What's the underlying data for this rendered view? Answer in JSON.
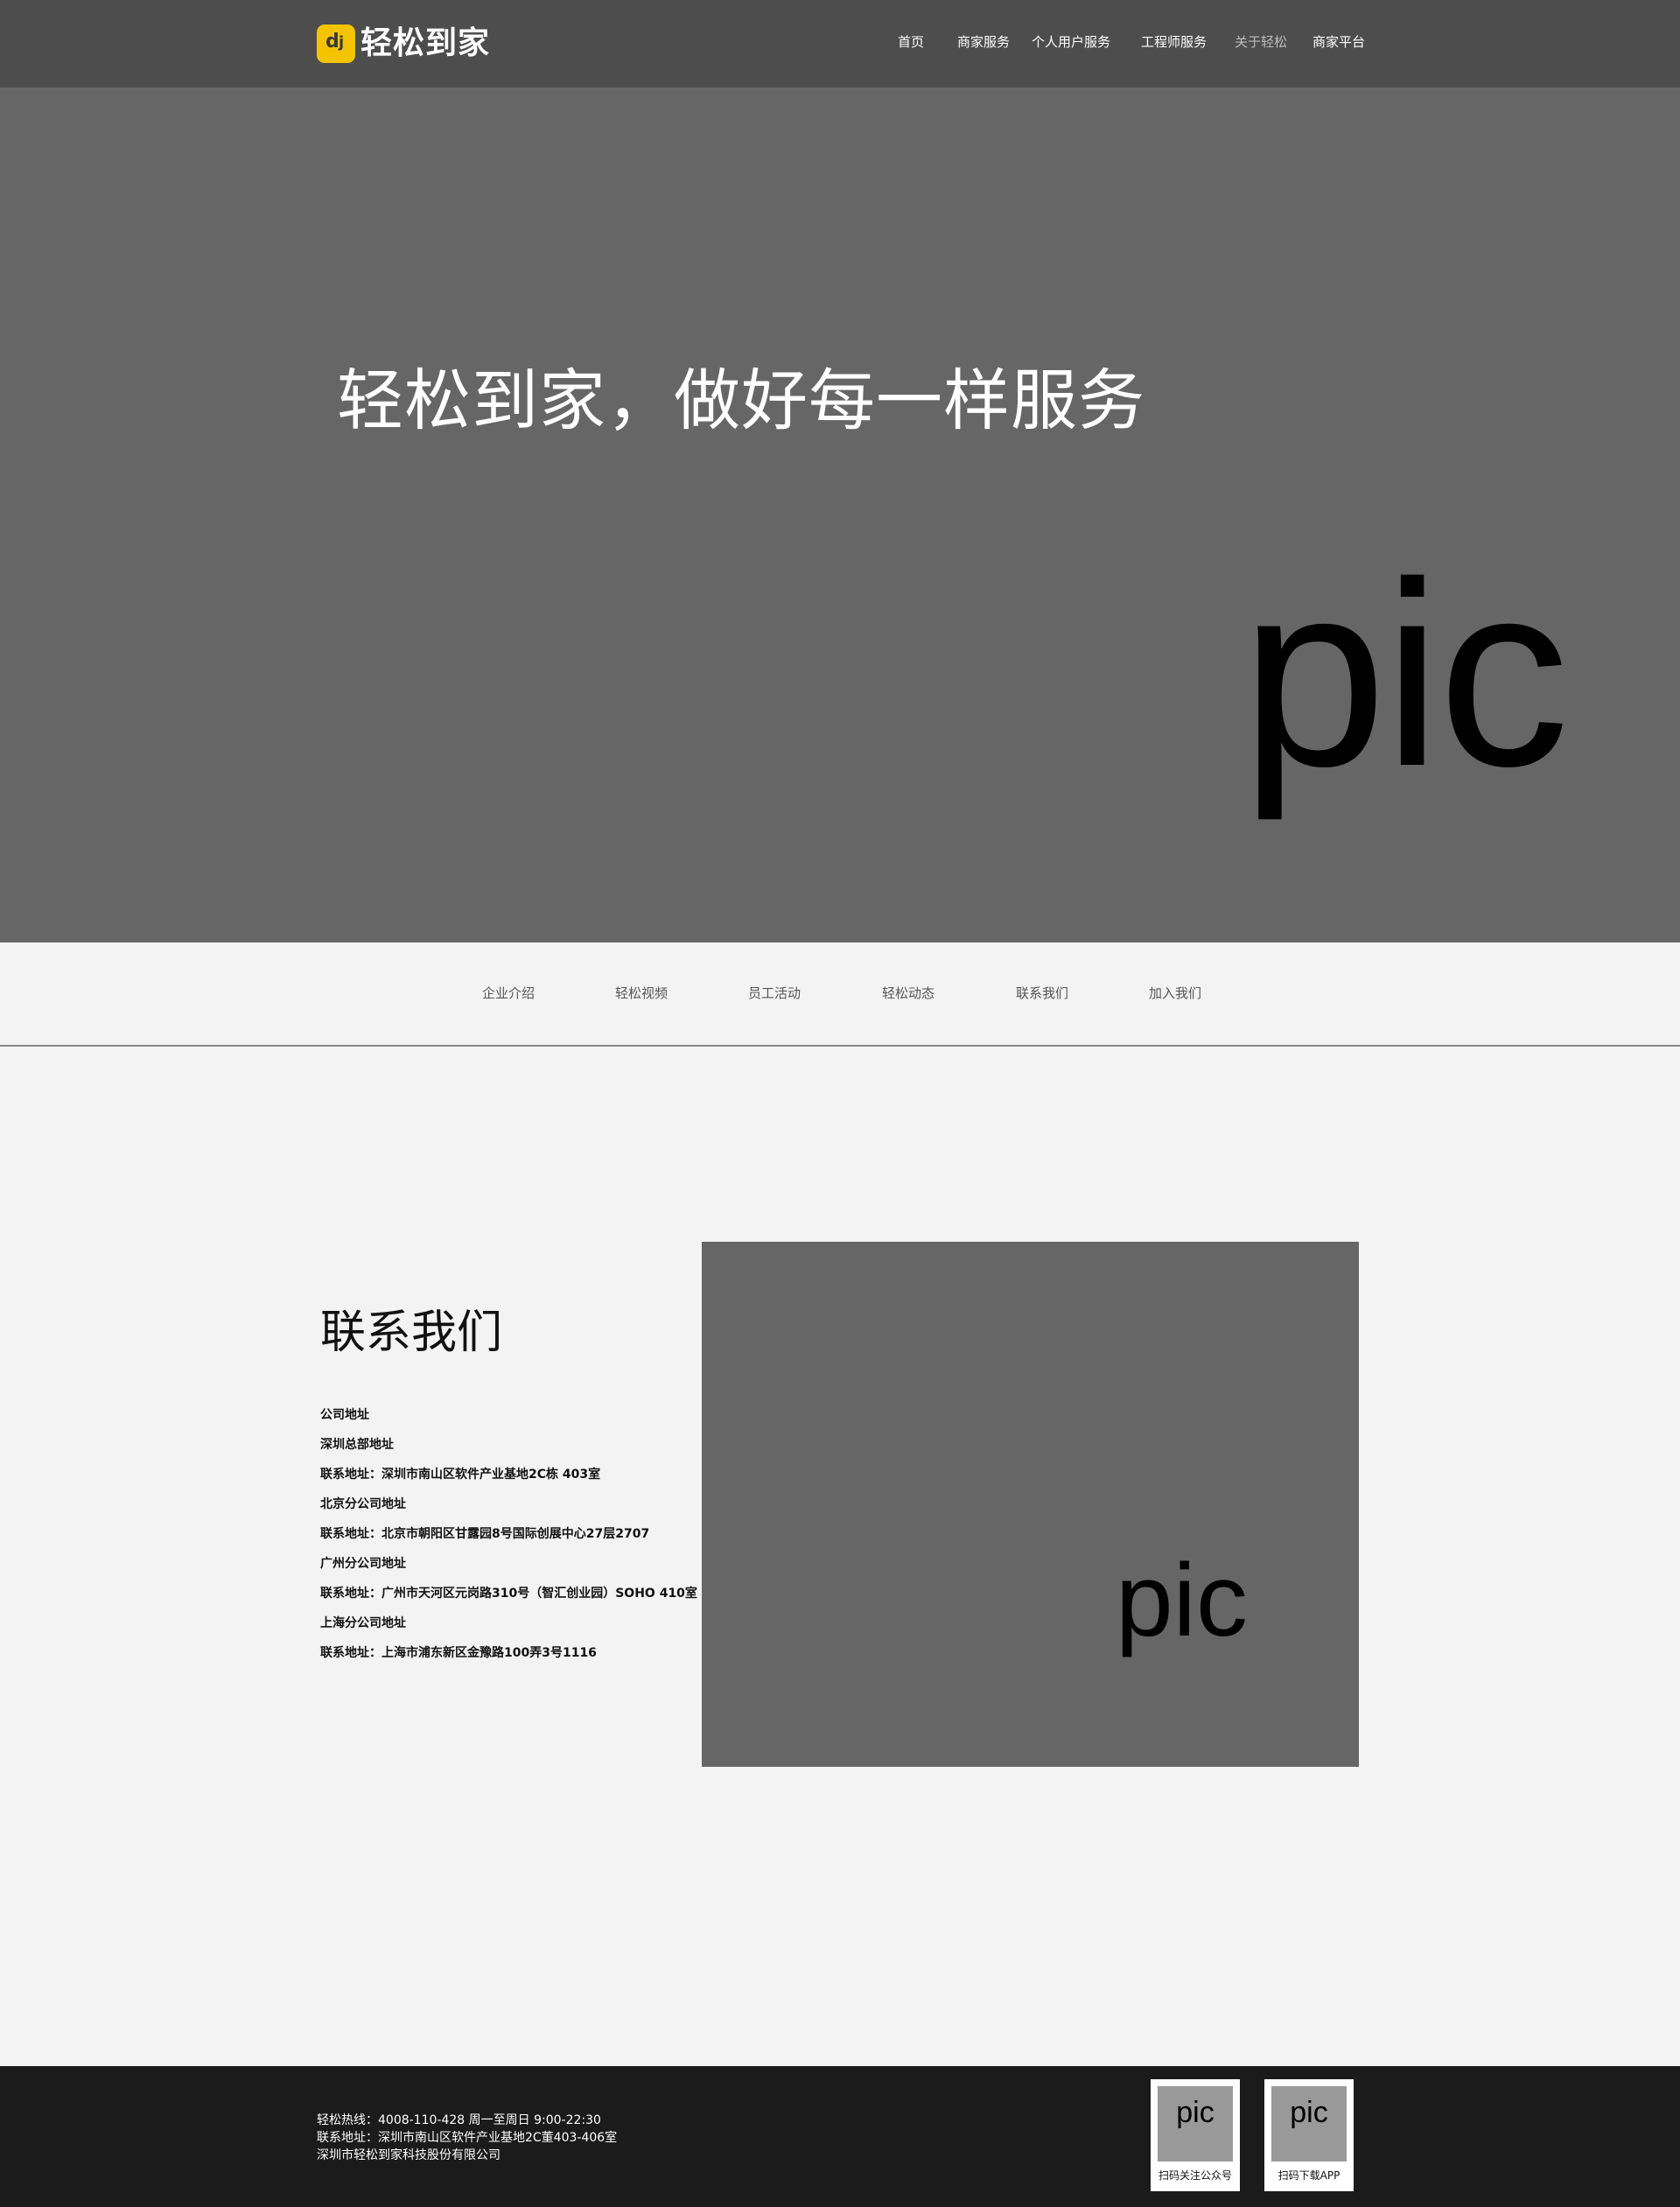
{
  "header": {
    "logo_text": "轻松到家",
    "nav": [
      {
        "label": "首页",
        "active": false
      },
      {
        "label": "商家服务",
        "active": false
      },
      {
        "label": "个人用户服务",
        "active": false
      },
      {
        "label": "工程师服务",
        "active": false
      },
      {
        "label": "关于轻松",
        "active": true
      },
      {
        "label": "商家平台",
        "active": false
      }
    ]
  },
  "hero": {
    "slogan": "轻松到家，做好每一样服务",
    "image_placeholder": "pic"
  },
  "subnav": {
    "items": [
      "企业介绍",
      "轻松视频",
      "员工活动",
      "轻松动态",
      "联系我们",
      "加入我们"
    ]
  },
  "contact": {
    "title": "联系我们",
    "lines": [
      "公司地址",
      "深圳总部地址",
      "联系地址：深圳市南山区软件产业基地2C栋 403室",
      "北京分公司地址",
      "联系地址：北京市朝阳区甘露园8号国际创展中心27层2707",
      "广州分公司地址",
      "联系地址：广州市天河区元岗路310号（智汇创业园）SOHO 410室",
      "上海分公司地址",
      "联系地址：上海市浦东新区金豫路100弄3号1116"
    ],
    "image_placeholder": "pic"
  },
  "footer": {
    "lines": [
      "轻松热线：4008-110-428 周一至周日 9:00-22:30",
      "联系地址：深圳市南山区软件产业基地2C董403-406室",
      "深圳市轻松到家科技股份有限公司"
    ],
    "qr_codes": [
      {
        "image_placeholder": "pic",
        "caption": "扫码关注公众号"
      },
      {
        "image_placeholder": "pic",
        "caption": "扫码下载APP"
      }
    ]
  },
  "colors": {
    "header_bg": "#4d4d4d",
    "hero_bg": "#666666",
    "page_bg": "#f3f3f3",
    "footer_bg": "#1b1b1b",
    "logo_accent": "#f5c400"
  }
}
